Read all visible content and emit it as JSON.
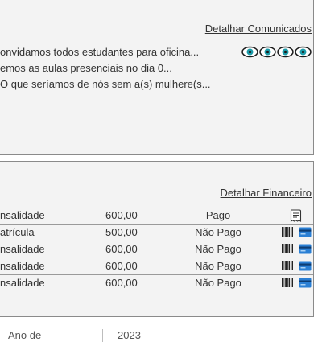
{
  "comunicados": {
    "detail_link": "Detalhar Comunicados",
    "items": [
      {
        "text": "onvidamos todos estudantes para oficina..."
      },
      {
        "text": "emos as aulas presenciais no dia 0..."
      },
      {
        "text": "O que seríamos de nós sem a(s) mulhere(s..."
      }
    ],
    "eye_icons": [
      "eye-icon",
      "eye-icon",
      "eye-icon",
      "eye-icon"
    ],
    "eye_color": "#1a9aa8"
  },
  "financeiro": {
    "detail_link": "Detalhar Financeiro",
    "rows": [
      {
        "desc": "nsalidade",
        "value": "600,00",
        "status": "Pago",
        "icons": [
          "receipt-icon"
        ]
      },
      {
        "desc": "atrícula",
        "value": "500,00",
        "status": "Não Pago",
        "icons": [
          "barcode-icon",
          "credit-card-icon"
        ]
      },
      {
        "desc": "nsalidade",
        "value": "600,00",
        "status": "Não Pago",
        "icons": [
          "barcode-icon",
          "credit-card-icon"
        ]
      },
      {
        "desc": "nsalidade",
        "value": "600,00",
        "status": "Não Pago",
        "icons": [
          "barcode-icon",
          "credit-card-icon"
        ]
      },
      {
        "desc": "nsalidade",
        "value": "600,00",
        "status": "Não Pago",
        "icons": [
          "barcode-icon",
          "credit-card-icon"
        ]
      }
    ],
    "card_color": "#2a7fd4"
  },
  "bottom": {
    "label": "Ano de",
    "value": "2023"
  }
}
